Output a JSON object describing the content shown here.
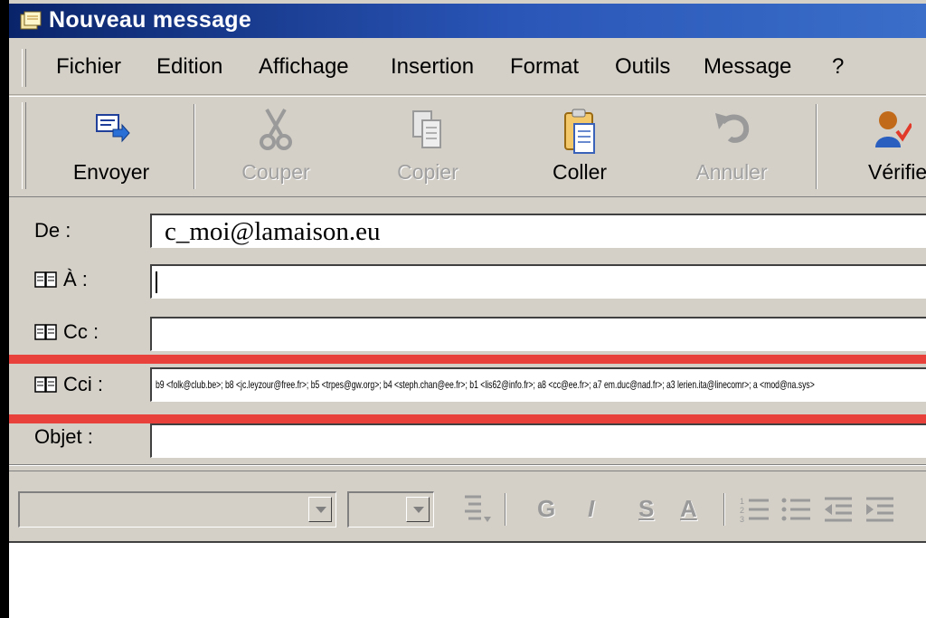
{
  "window": {
    "title": "Nouveau message"
  },
  "menu": {
    "items": [
      "Fichier",
      "Edition",
      "Affichage",
      "Insertion",
      "Format",
      "Outils",
      "Message",
      "?"
    ]
  },
  "toolbar": {
    "send": "Envoyer",
    "cut": "Couper",
    "copy": "Copier",
    "paste": "Coller",
    "undo": "Annuler",
    "check": "Vérifie"
  },
  "fields": {
    "from_label": "De :",
    "from_value": "c_moi@lamaison.eu",
    "to_label": "À :",
    "to_value": "",
    "cc_label": "Cc :",
    "cc_value": "",
    "bcc_label": "Cci :",
    "bcc_value": "b9 <folk@club.be>; b8 <jc.leyzour@free.fr>; b5 <trpes@gw.org>; b4 <steph.chan@ee.fr>; b1 <lis62@info.fr>; a8 <cc@ee.fr>; a7 em.duc@nad.fr>; a3 lerien.ita@linecomr>; a <mod@na.sys>",
    "subject_label": "Objet :",
    "subject_value": ""
  },
  "format_bar": {
    "bold": "G",
    "italic": "I",
    "underline": "S",
    "color": "A"
  },
  "colors": {
    "titlebar": "#0a246a",
    "highlight": "#e8403a",
    "face": "#d4d0c8"
  }
}
